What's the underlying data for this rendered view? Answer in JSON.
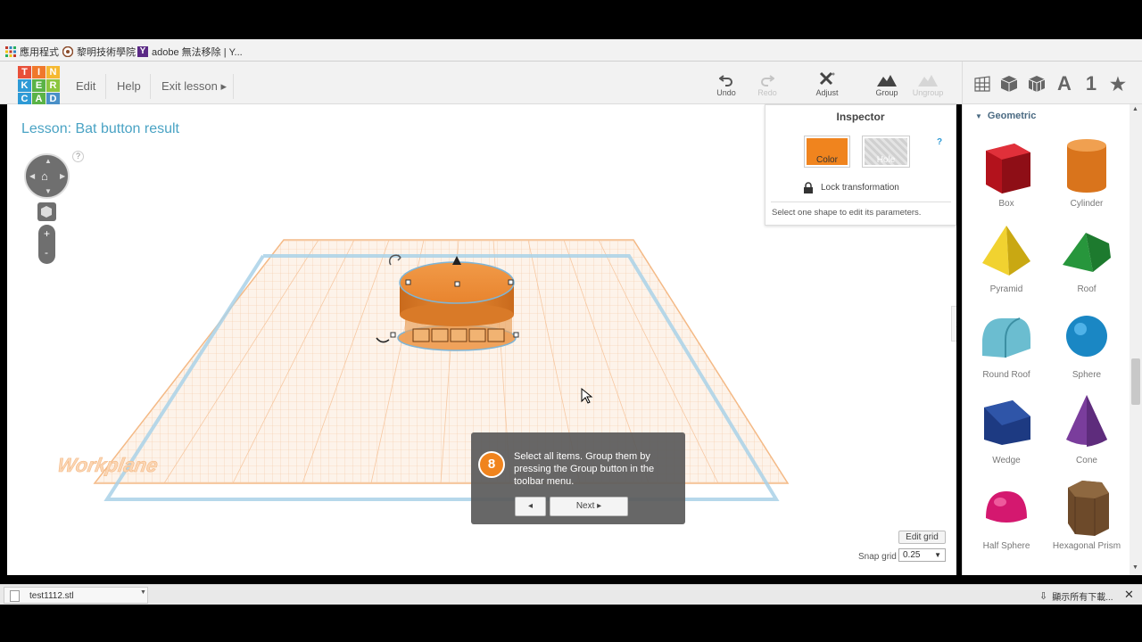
{
  "bookmarks": [
    {
      "label": "應用程式",
      "icon": "apps-grid-icon"
    },
    {
      "label": "黎明技術學院",
      "icon": "school-logo-icon"
    },
    {
      "label": "adobe 無法移除 | Y...",
      "icon": "yahoo-icon"
    }
  ],
  "logo": {
    "letters": [
      "T",
      "I",
      "N",
      "K",
      "E",
      "R",
      "C",
      "A",
      "D"
    ],
    "colors": [
      "#e8503a",
      "#f0782b",
      "#f5b932",
      "#2e9ad6",
      "#5ab346",
      "#8dc63f",
      "#2e9ad6",
      "#5ab346",
      "#4a90c8"
    ]
  },
  "menu": {
    "edit": "Edit",
    "help": "Help",
    "exit": "Exit lesson ▸"
  },
  "toolbar": {
    "undo": "Undo",
    "redo": "Redo",
    "adjust": "Adjust",
    "group": "Group",
    "ungroup": "Ungroup"
  },
  "panel_tabs": {
    "text_tab": "A",
    "number_tab": "1",
    "favorite_tab": "★"
  },
  "lesson": {
    "title": "Lesson: Bat button result"
  },
  "view": {
    "help": "?"
  },
  "inspector": {
    "title": "Inspector",
    "color_label": "Color",
    "hole_label": "Hole",
    "help": "?",
    "lock_label": "Lock transformation",
    "hint": "Select one shape to edit its parameters."
  },
  "workplane": {
    "label": "Workplane"
  },
  "tutorial": {
    "step": "8",
    "text": "Select all items. Group them by pressing the Group button in the toolbar menu.",
    "back": "◂",
    "next": "Next ▸"
  },
  "grid": {
    "edit_label": "Edit grid",
    "snap_label": "Snap grid",
    "snap_value": "0.25"
  },
  "library": {
    "section": "Geometric",
    "shapes": [
      {
        "name": "Box"
      },
      {
        "name": "Cylinder"
      },
      {
        "name": "Pyramid"
      },
      {
        "name": "Roof"
      },
      {
        "name": "Round Roof"
      },
      {
        "name": "Sphere"
      },
      {
        "name": "Wedge"
      },
      {
        "name": "Cone"
      },
      {
        "name": "Half Sphere"
      },
      {
        "name": "Hexagonal Prism"
      }
    ]
  },
  "downloads": {
    "file": "test1112.stl",
    "show_all": "顯示所有下載..."
  },
  "colors": {
    "accent": "#4aa3c4",
    "orange": "#f0841e",
    "grid": "#f3b98a"
  }
}
